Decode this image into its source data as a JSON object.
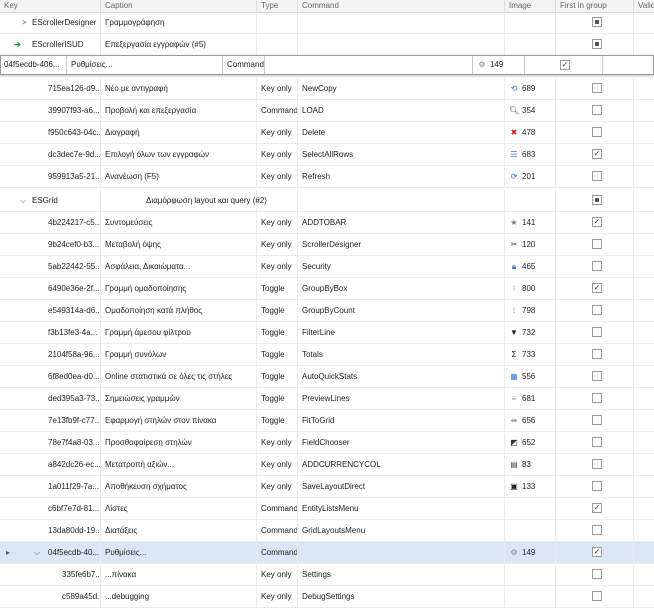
{
  "columns": {
    "key": "Key",
    "caption": "Caption",
    "type": "Type",
    "command": "Command",
    "image": "Image",
    "first_in_group": "First in group",
    "valid": "Valid"
  },
  "group_rows": [
    {
      "key": "EScrollerDesigner",
      "caption": "Γραμμογράφηση",
      "first": "indeterminate"
    },
    {
      "key": "EScrollerISUD",
      "caption": "Επεξεργασία εγγραφών (#5)",
      "first": "indeterminate"
    }
  ],
  "editor_row": {
    "key": "04f5ecdb-406...",
    "caption": "Ρυθμίσεις...",
    "type": "Command",
    "image_value": "149",
    "first": "checked"
  },
  "rows_a": [
    {
      "key": "715ea126-d9...",
      "caption": "Νέο με αντιγραφή",
      "type": "Key only",
      "command": "NewCopy",
      "icon": "copy-icon",
      "glyph": "⟲",
      "icolor": "#3a7bd5",
      "image": "689",
      "first": "unchecked"
    },
    {
      "key": "39907f93-a6...",
      "caption": "Προβολή και επεξεργασία",
      "type": "Command",
      "command": "LOAD",
      "icon": "search-icon",
      "glyph": "🔍︎",
      "icolor": "#444",
      "image": "354",
      "first": "unchecked"
    },
    {
      "key": "f950c643-04c...",
      "caption": "Διαγραφή",
      "type": "Key only",
      "command": "Delete",
      "icon": "delete-x-icon",
      "glyph": "✖",
      "icolor": "#d01818",
      "image": "478",
      "first": "unchecked"
    },
    {
      "key": "dc3dec7e-9d...",
      "caption": "Επιλογή όλων των εγγραφών",
      "type": "Key only",
      "command": "SelectAllRows",
      "icon": "list-icon",
      "glyph": "☰",
      "icolor": "#3a7bd5",
      "image": "683",
      "first": "checked"
    },
    {
      "key": "959913a5-21...",
      "caption": "Ανανέωση (F5)",
      "type": "Key only",
      "command": "Refresh",
      "icon": "refresh-icon",
      "glyph": "⟳",
      "icolor": "#2a6fc9",
      "image": "201",
      "first": "unchecked"
    }
  ],
  "esgrid": {
    "key": "ESGrid",
    "caption": "Διαμόρφωση layout και query (#2)",
    "first": "indeterminate"
  },
  "rows_b": [
    {
      "key": "4b224217-c5...",
      "caption": "Συντομεύσεις",
      "type": "Key only",
      "command": "ADDTOBAR",
      "icon": "star-icon",
      "glyph": "★",
      "icolor": "#777",
      "image": "141",
      "first": "checked"
    },
    {
      "key": "9b24cef0-b3...",
      "caption": "Μεταβολή όψης",
      "type": "Key only",
      "command": "ScrollerDesigner",
      "icon": "tools-icon",
      "glyph": "✂",
      "icolor": "#333",
      "image": "120",
      "first": "unchecked"
    },
    {
      "key": "5ab22442-55...",
      "caption": "Ασφάλεια, Δικαιώματα...",
      "type": "Key only",
      "command": "Security",
      "icon": "lock-icon",
      "glyph": "🔒︎",
      "icolor": "#2a6fc9",
      "image": "465",
      "first": "unchecked"
    },
    {
      "key": "6490e36e-2f...",
      "caption": "Γραμμή ομαδοποίησης",
      "type": "Toggle",
      "command": "GroupByBox",
      "icon": "group-icon",
      "glyph": "⁝",
      "icolor": "#3a7bd5",
      "image": "800",
      "first": "checked"
    },
    {
      "key": "e549314a-d6...",
      "caption": "Ομαδοποίηση κατά πλήθος",
      "type": "Toggle",
      "command": "GroupByCount",
      "icon": "group-count-icon",
      "glyph": "⁝",
      "icolor": "#3a7bd5",
      "image": "798",
      "first": "unchecked"
    },
    {
      "key": "f3b13fe3-4a...",
      "caption": "Γραμμή άμεσου φίλτρου",
      "type": "Toggle",
      "command": "FilterLine",
      "icon": "filter-icon",
      "glyph": "▼",
      "icolor": "#222",
      "image": "732",
      "first": "unchecked"
    },
    {
      "key": "2104f58a-96...",
      "caption": "Γραμμή συνόλων",
      "type": "Toggle",
      "command": "Totals",
      "icon": "sigma-icon",
      "glyph": "Σ",
      "icolor": "#222",
      "image": "733",
      "first": "unchecked"
    },
    {
      "key": "6f8ed0ea-d0...",
      "caption": "Online στατιστικά σε όλες τις στήλες",
      "type": "Toggle",
      "command": "AutoQuickStats",
      "icon": "stats-icon",
      "glyph": "▦",
      "icolor": "#3a7bd5",
      "image": "556",
      "first": "unchecked"
    },
    {
      "key": "ded395a3-73...",
      "caption": "Σημειώσεις γραμμών",
      "type": "Toggle",
      "command": "PreviewLines",
      "icon": "preview-icon",
      "glyph": "≡",
      "icolor": "#999",
      "image": "681",
      "first": "unchecked"
    },
    {
      "key": "7e13fb9f-c77...",
      "caption": "Εφαρμογή στηλών στον πίνακα",
      "type": "Toggle",
      "command": "FitToGrid",
      "icon": "fit-icon",
      "glyph": "⇹",
      "icolor": "#888",
      "image": "656",
      "first": "unchecked"
    },
    {
      "key": "78e7f4a8-03...",
      "caption": "Προσθαφαίρεση στηλών",
      "type": "Key only",
      "command": "FieldChooser",
      "icon": "field-chooser-icon",
      "glyph": "◩",
      "icolor": "#333",
      "image": "652",
      "first": "unchecked"
    },
    {
      "key": "a842dc26-ec...",
      "caption": "Μετατροπή αξιών...",
      "type": "Key only",
      "command": "ADDCURRENCYCOL",
      "icon": "calculator-icon",
      "glyph": "▤",
      "icolor": "#444",
      "image": "83",
      "first": "unchecked"
    },
    {
      "key": "1a011f29-7a...",
      "caption": "Αποθήκευση σχήματος",
      "type": "Key only",
      "command": "SaveLayoutDirect",
      "icon": "save-icon",
      "glyph": "▣",
      "icolor": "#222",
      "image": "133",
      "first": "unchecked"
    },
    {
      "key": "c6bf7e7d-81...",
      "caption": "Λίστες",
      "type": "Command",
      "command": "EntityListsMenu",
      "icon": "",
      "glyph": "",
      "icolor": "#222",
      "image": "",
      "first": "checked"
    },
    {
      "key": "13da80dd-19...",
      "caption": "Διατάξεις",
      "type": "Command",
      "command": "GridLayoutsMenu",
      "icon": "",
      "glyph": "",
      "icolor": "#222",
      "image": "",
      "first": "unchecked"
    }
  ],
  "selected_row": {
    "key": "04f5ecdb-40...",
    "caption": "Ρυθμίσεις...",
    "type": "Command",
    "command": "",
    "image": "149",
    "first": "checked"
  },
  "rows_c": [
    {
      "key": "335fe6b7...",
      "caption": "...πίνακα",
      "type": "Key only",
      "command": "Settings",
      "first": "unchecked"
    },
    {
      "key": "c589a45d...",
      "caption": "...debugging",
      "type": "Key only",
      "command": "DebugSettings",
      "first": "unchecked"
    }
  ]
}
